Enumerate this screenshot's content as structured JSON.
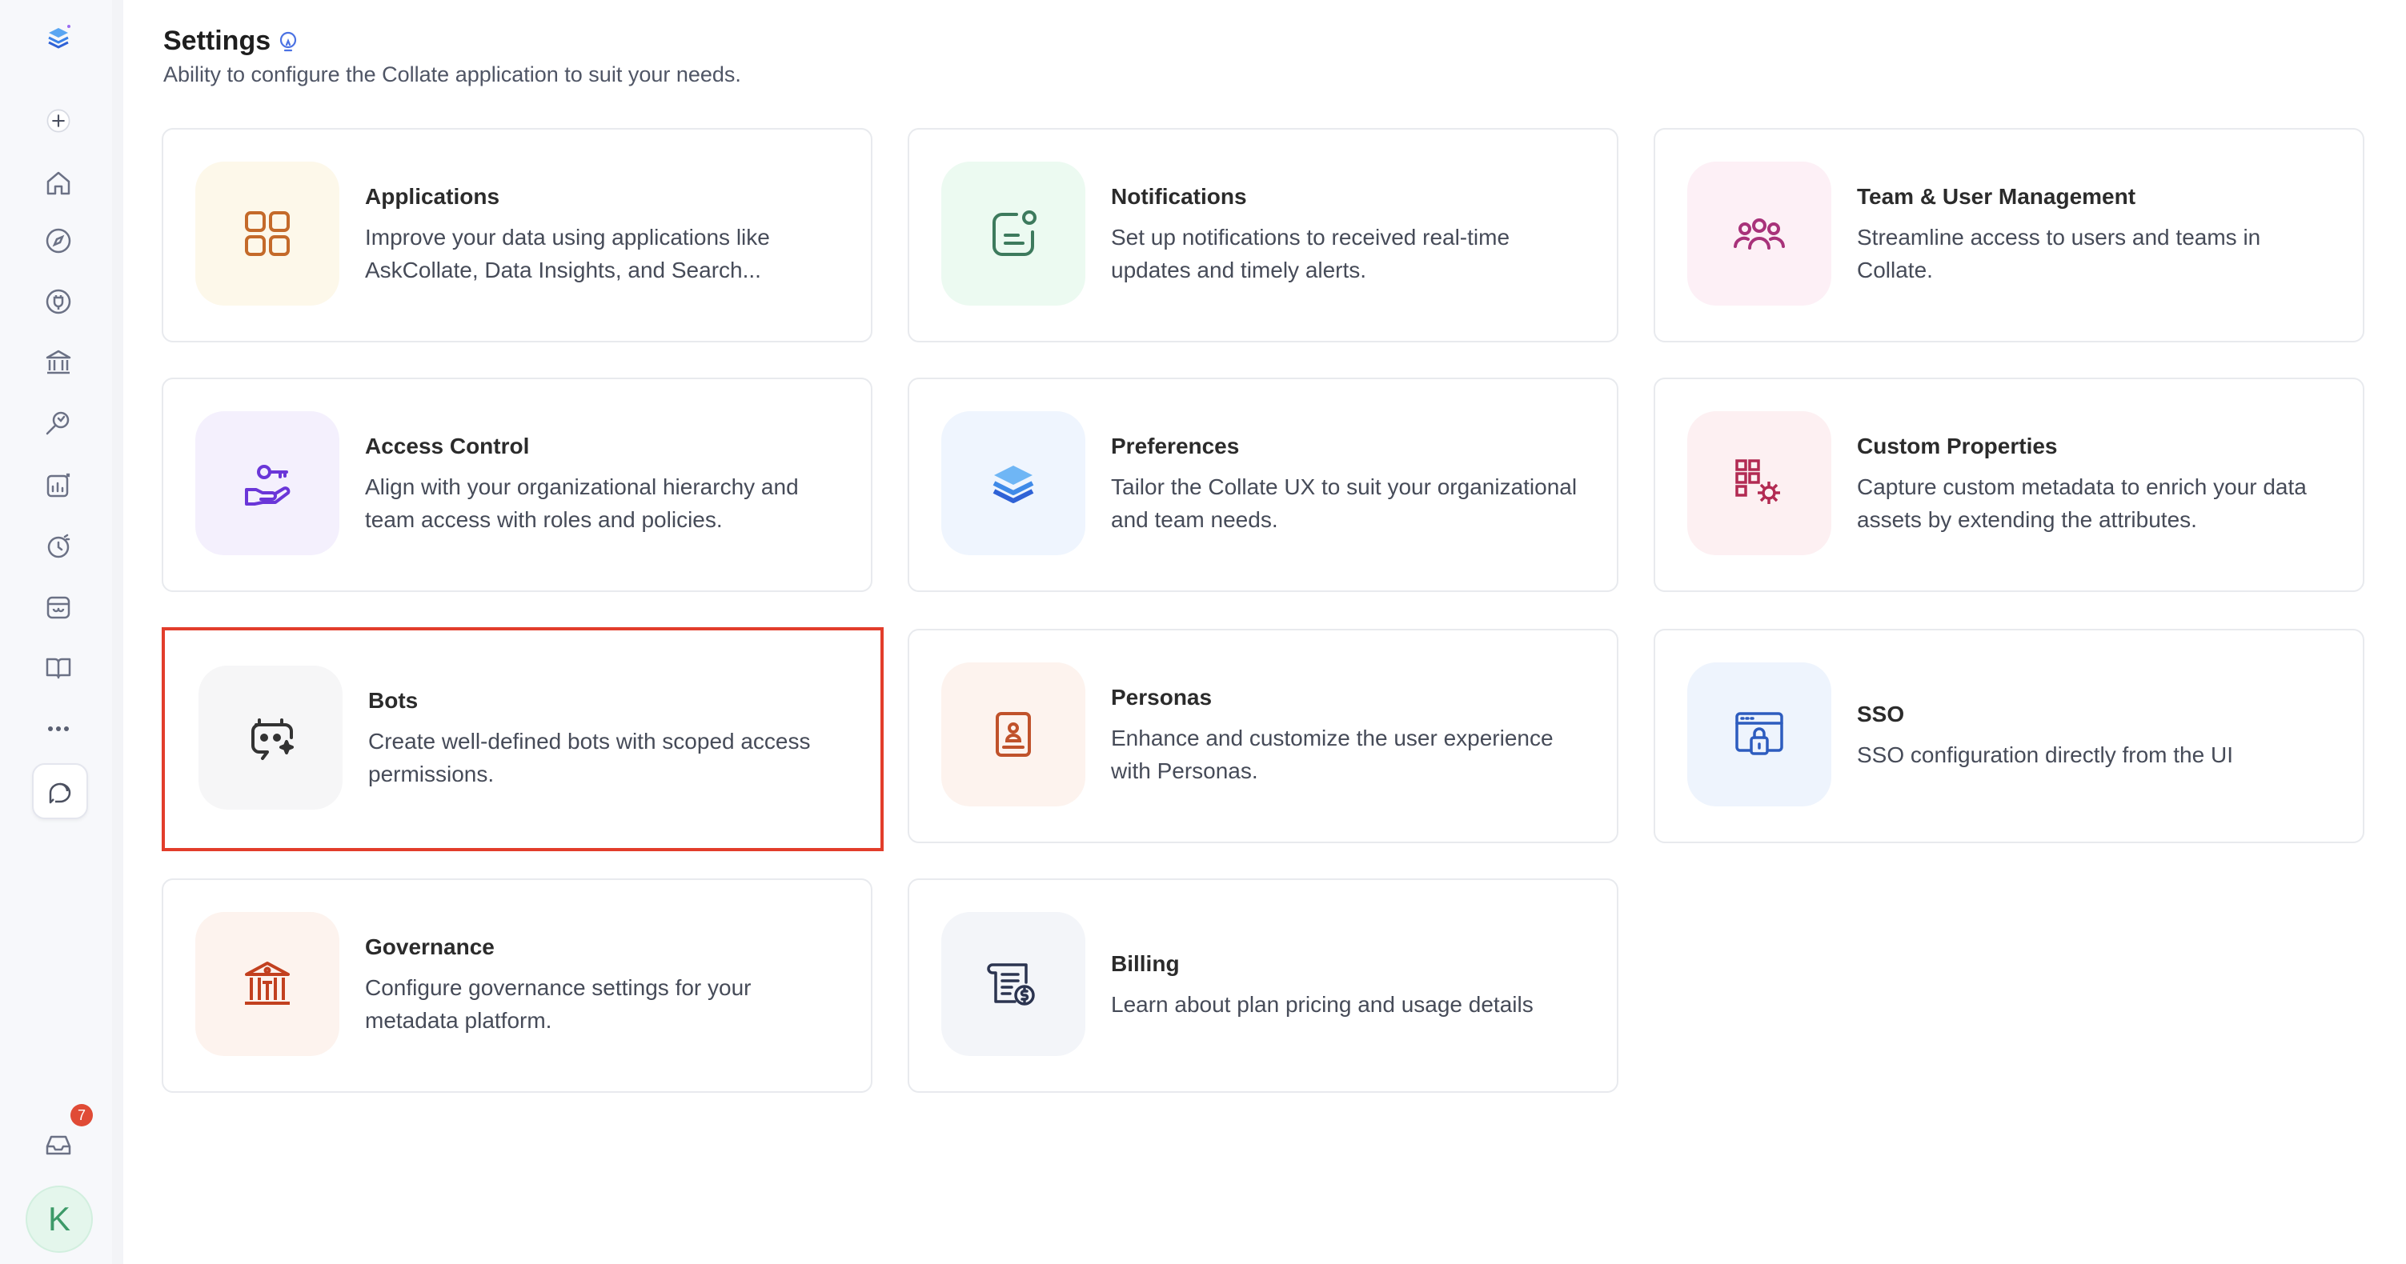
{
  "page": {
    "title": "Settings",
    "subtitle": "Ability to configure the Collate application to suit your needs."
  },
  "sidebar": {
    "notification_count": "7",
    "avatar_initial": "K"
  },
  "cards": [
    {
      "title": "Applications",
      "description": "Improve your data using applications like AskCollate, Data Insights, and Search...",
      "icon": "applications-grid-icon",
      "color": "#c46a2a",
      "bg": "#fdf8ea"
    },
    {
      "title": "Notifications",
      "description": "Set up notifications to received real-time updates and timely alerts.",
      "icon": "notification-message-icon",
      "color": "#3d7a5d",
      "bg": "#ecfaf1"
    },
    {
      "title": "Team & User Management",
      "description": "Streamline access to users and teams in Collate.",
      "icon": "team-users-icon",
      "color": "#a8327a",
      "bg": "#fdf0f6"
    },
    {
      "title": "Access Control",
      "description": "Align with your organizational hierarchy and team access with roles and policies.",
      "icon": "key-hand-icon",
      "color": "#6a36d8",
      "bg": "#f4f0fd"
    },
    {
      "title": "Preferences",
      "description": "Tailor the Collate UX to suit your organizational and team needs.",
      "icon": "layers-stack-icon",
      "color": "#3778e8",
      "bg": "#eff5fe"
    },
    {
      "title": "Custom Properties",
      "description": "Capture custom metadata to enrich your data assets by extending the attributes.",
      "icon": "grid-gear-icon",
      "color": "#b22a52",
      "bg": "#fdf0f2"
    },
    {
      "title": "Bots",
      "description": "Create well-defined bots with scoped access permissions.",
      "icon": "bot-icon",
      "color": "#333333",
      "bg": "#f6f6f7"
    },
    {
      "title": "Personas",
      "description": "Enhance and customize the user experience with Personas.",
      "icon": "persona-badge-icon",
      "color": "#c0522b",
      "bg": "#fdf3ee"
    },
    {
      "title": "SSO",
      "description": "SSO configuration directly from the UI",
      "icon": "browser-lock-icon",
      "color": "#2d5cbf",
      "bg": "#eef4fd"
    },
    {
      "title": "Governance",
      "description": "Configure governance settings for your metadata platform.",
      "icon": "bank-building-icon",
      "color": "#c2401f",
      "bg": "#fdf3ee"
    },
    {
      "title": "Billing",
      "description": "Learn about plan pricing and usage details",
      "icon": "billing-receipt-icon",
      "color": "#2b3450",
      "bg": "#f3f5f9"
    }
  ]
}
